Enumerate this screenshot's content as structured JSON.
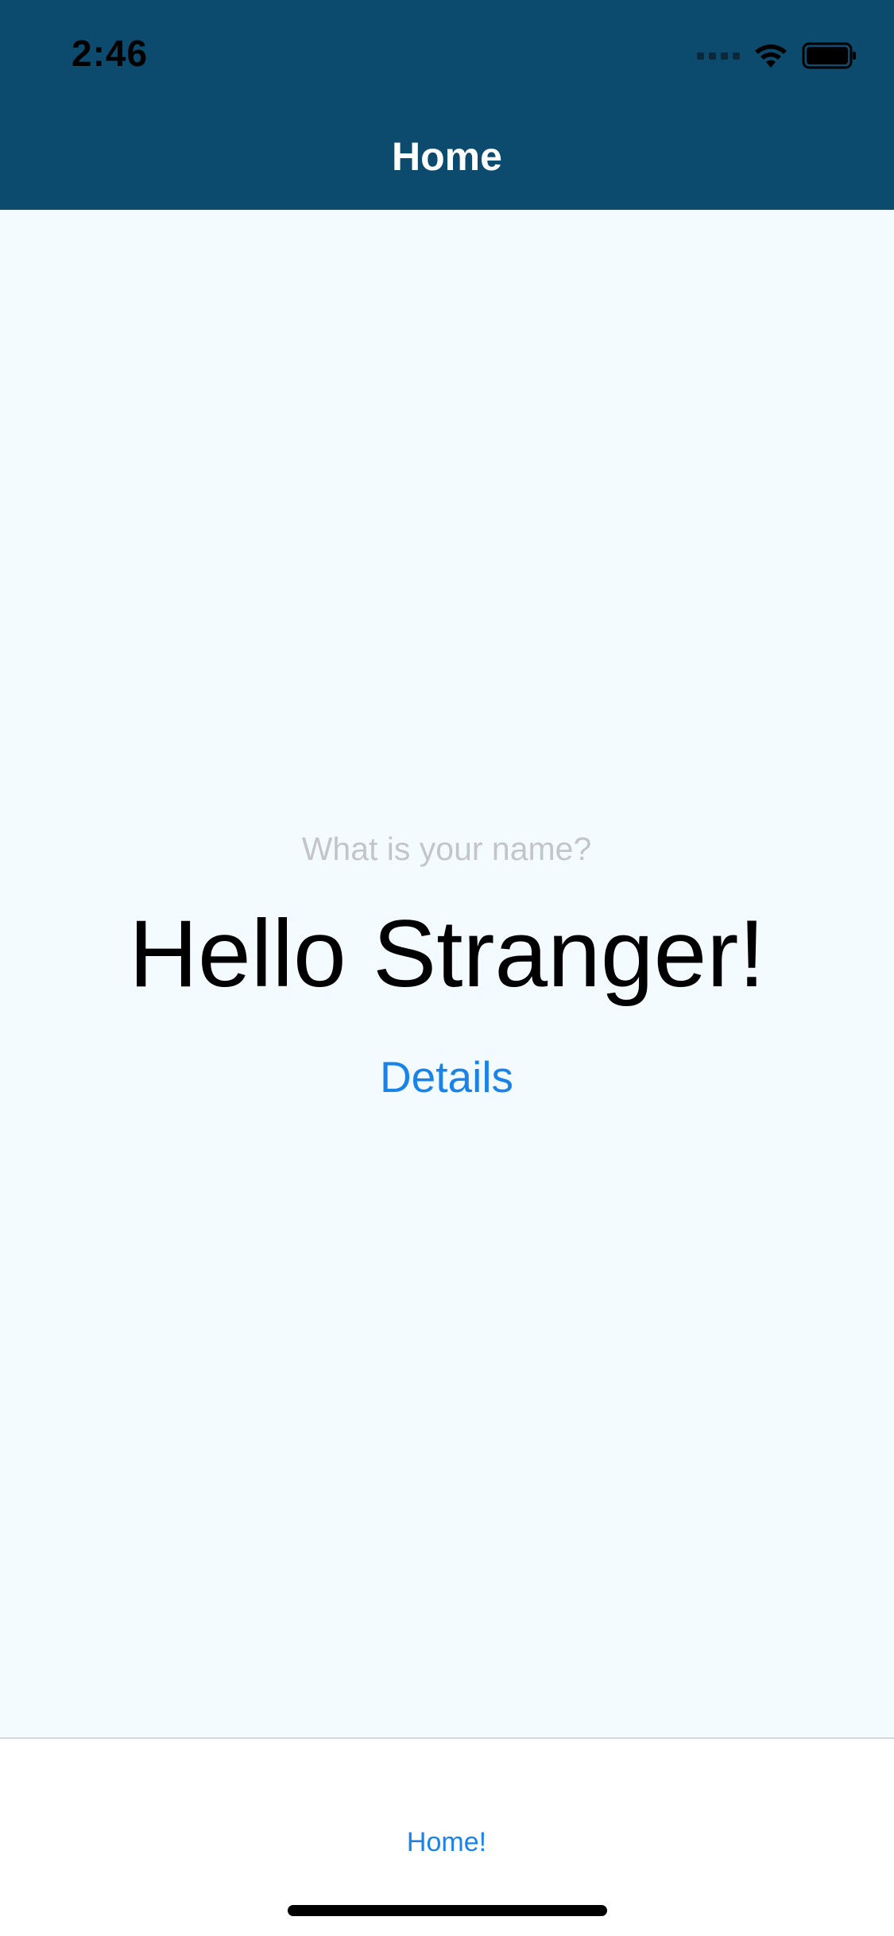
{
  "status_bar": {
    "time": "2:46",
    "signal_icon": "cellular-signal-icon",
    "wifi_icon": "wifi-icon",
    "battery_icon": "battery-icon"
  },
  "nav": {
    "title": "Home"
  },
  "main": {
    "name_input": {
      "value": "",
      "placeholder": "What is your name?"
    },
    "greeting": "Hello Stranger!",
    "details_label": "Details"
  },
  "tab_bar": {
    "items": [
      {
        "label": "Home!",
        "selected": true
      }
    ]
  },
  "colors": {
    "header_bg": "#0c4a6e",
    "content_bg": "#f4fbfe",
    "accent": "#1a83e8",
    "placeholder": "#c3c6c9"
  }
}
